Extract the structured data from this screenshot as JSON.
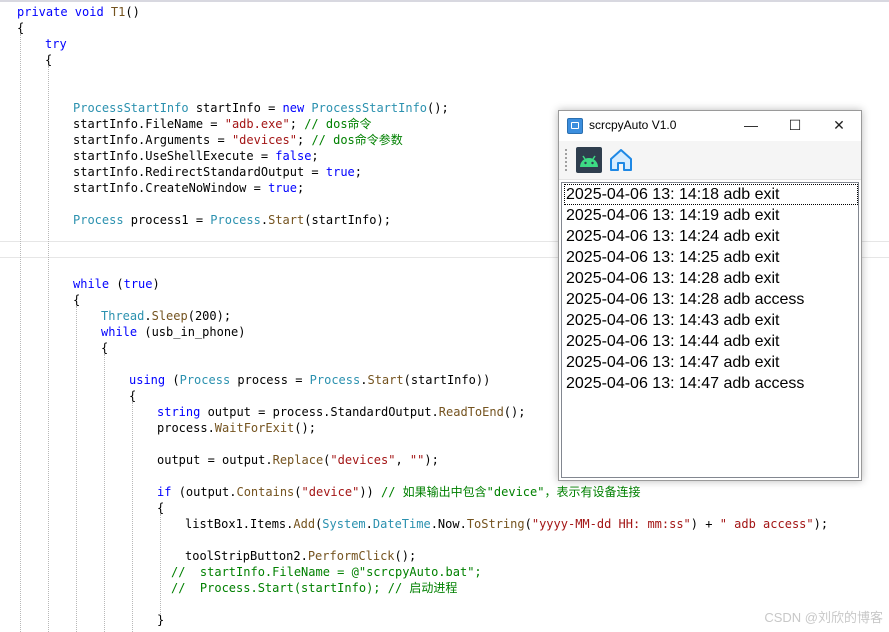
{
  "editor": {
    "lines": [
      [
        [
          "kw",
          "private "
        ],
        [
          "kw",
          "void "
        ],
        [
          "mt",
          "T1"
        ],
        [
          "tx",
          "()"
        ]
      ],
      [
        [
          "tx",
          "{"
        ]
      ],
      [
        [
          "kw",
          "try"
        ]
      ],
      [
        [
          "tx",
          "{"
        ]
      ],
      [
        [
          "ty",
          "ProcessStartInfo"
        ],
        [
          "tx",
          " startInfo = "
        ],
        [
          "kw",
          "new "
        ],
        [
          "ty",
          "ProcessStartInfo"
        ],
        [
          "tx",
          "();"
        ]
      ],
      [
        [
          "tx",
          "startInfo.FileName = "
        ],
        [
          "st",
          "\"adb.exe\""
        ],
        [
          "tx",
          "; "
        ],
        [
          "cm",
          "// dos命令"
        ]
      ],
      [
        [
          "tx",
          "startInfo.Arguments = "
        ],
        [
          "st",
          "\"devices\""
        ],
        [
          "tx",
          "; "
        ],
        [
          "cm",
          "// dos命令参数"
        ]
      ],
      [
        [
          "tx",
          "startInfo.UseShellExecute = "
        ],
        [
          "kw",
          "false"
        ],
        [
          "tx",
          ";"
        ]
      ],
      [
        [
          "tx",
          "startInfo.RedirectStandardOutput = "
        ],
        [
          "kw",
          "true"
        ],
        [
          "tx",
          ";"
        ]
      ],
      [
        [
          "tx",
          "startInfo.CreateNoWindow = "
        ],
        [
          "kw",
          "true"
        ],
        [
          "tx",
          ";"
        ]
      ],
      [
        [
          "ty",
          "Process"
        ],
        [
          "tx",
          " process1 = "
        ],
        [
          "ty",
          "Process"
        ],
        [
          "tx",
          "."
        ],
        [
          "mt",
          "Start"
        ],
        [
          "tx",
          "(startInfo);"
        ]
      ],
      [
        [
          "kw",
          "while "
        ],
        [
          "tx",
          "("
        ],
        [
          "kw",
          "true"
        ],
        [
          "tx",
          ")"
        ]
      ],
      [
        [
          "tx",
          "{"
        ]
      ],
      [
        [
          "ty",
          "Thread"
        ],
        [
          "tx",
          "."
        ],
        [
          "mt",
          "Sleep"
        ],
        [
          "tx",
          "(200);"
        ]
      ],
      [
        [
          "kw",
          "while "
        ],
        [
          "tx",
          "(usb_in_phone)"
        ]
      ],
      [
        [
          "tx",
          "{"
        ]
      ],
      [
        [
          "kw",
          "using "
        ],
        [
          "tx",
          "("
        ],
        [
          "ty",
          "Process"
        ],
        [
          "tx",
          " process = "
        ],
        [
          "ty",
          "Process"
        ],
        [
          "tx",
          "."
        ],
        [
          "mt",
          "Start"
        ],
        [
          "tx",
          "(startInfo))"
        ]
      ],
      [
        [
          "tx",
          "{"
        ]
      ],
      [
        [
          "kw",
          "string "
        ],
        [
          "tx",
          "output = process.StandardOutput."
        ],
        [
          "mt",
          "ReadToEnd"
        ],
        [
          "tx",
          "();"
        ]
      ],
      [
        [
          "tx",
          "process."
        ],
        [
          "mt",
          "WaitForExit"
        ],
        [
          "tx",
          "();"
        ]
      ],
      [
        [
          "tx",
          "output = output."
        ],
        [
          "mt",
          "Replace"
        ],
        [
          "tx",
          "("
        ],
        [
          "st",
          "\"devices\""
        ],
        [
          "tx",
          ", "
        ],
        [
          "st",
          "\"\""
        ],
        [
          "tx",
          ");"
        ]
      ],
      [
        [
          "kw",
          "if "
        ],
        [
          "tx",
          "(output."
        ],
        [
          "mt",
          "Contains"
        ],
        [
          "tx",
          "("
        ],
        [
          "st",
          "\"device\""
        ],
        [
          "tx",
          ")) "
        ],
        [
          "cm",
          "// 如果输出中包含\"device\"，表示有设备连接"
        ]
      ],
      [
        [
          "tx",
          "{"
        ]
      ],
      [
        [
          "tx",
          "listBox1.Items."
        ],
        [
          "mt",
          "Add"
        ],
        [
          "tx",
          "("
        ],
        [
          "ty",
          "System"
        ],
        [
          "tx",
          "."
        ],
        [
          "ty",
          "DateTime"
        ],
        [
          "tx",
          ".Now."
        ],
        [
          "mt",
          "ToString"
        ],
        [
          "tx",
          "("
        ],
        [
          "st",
          "\"yyyy-MM-dd HH: mm:ss\""
        ],
        [
          "tx",
          ") + "
        ],
        [
          "st",
          "\" adb access\""
        ],
        [
          "tx",
          ");"
        ]
      ],
      [
        [
          "tx",
          "toolStripButton2."
        ],
        [
          "mt",
          "PerformClick"
        ],
        [
          "tx",
          "();"
        ]
      ],
      [
        [
          "cm",
          "//  startInfo.FileName = @\"scrcpyAuto.bat\";"
        ]
      ],
      [
        [
          "cm",
          "//  Process.Start(startInfo); // 启动进程"
        ]
      ],
      [
        [
          "tx",
          "}"
        ]
      ]
    ]
  },
  "window": {
    "title": "scrcpyAuto V1.0",
    "minimize": "—",
    "maximize": "☐",
    "close": "✕",
    "toolbar": {
      "icons": [
        "android-icon",
        "home-icon"
      ],
      "android_color": "#3ddc84",
      "home_color": "#1e88e5"
    },
    "listbox": {
      "items": [
        "2025-04-06 13: 14:18 adb exit",
        "2025-04-06 13: 14:19 adb exit",
        "2025-04-06 13: 14:24 adb exit",
        "2025-04-06 13: 14:25 adb exit",
        "2025-04-06 13: 14:28 adb exit",
        "2025-04-06 13: 14:28 adb access",
        "2025-04-06 13: 14:43 adb exit",
        "2025-04-06 13: 14:44 adb exit",
        "2025-04-06 13: 14:47 adb exit",
        "2025-04-06 13: 14:47 adb access"
      ],
      "focused_index": 0
    }
  },
  "watermark": "CSDN @刘欣的博客"
}
